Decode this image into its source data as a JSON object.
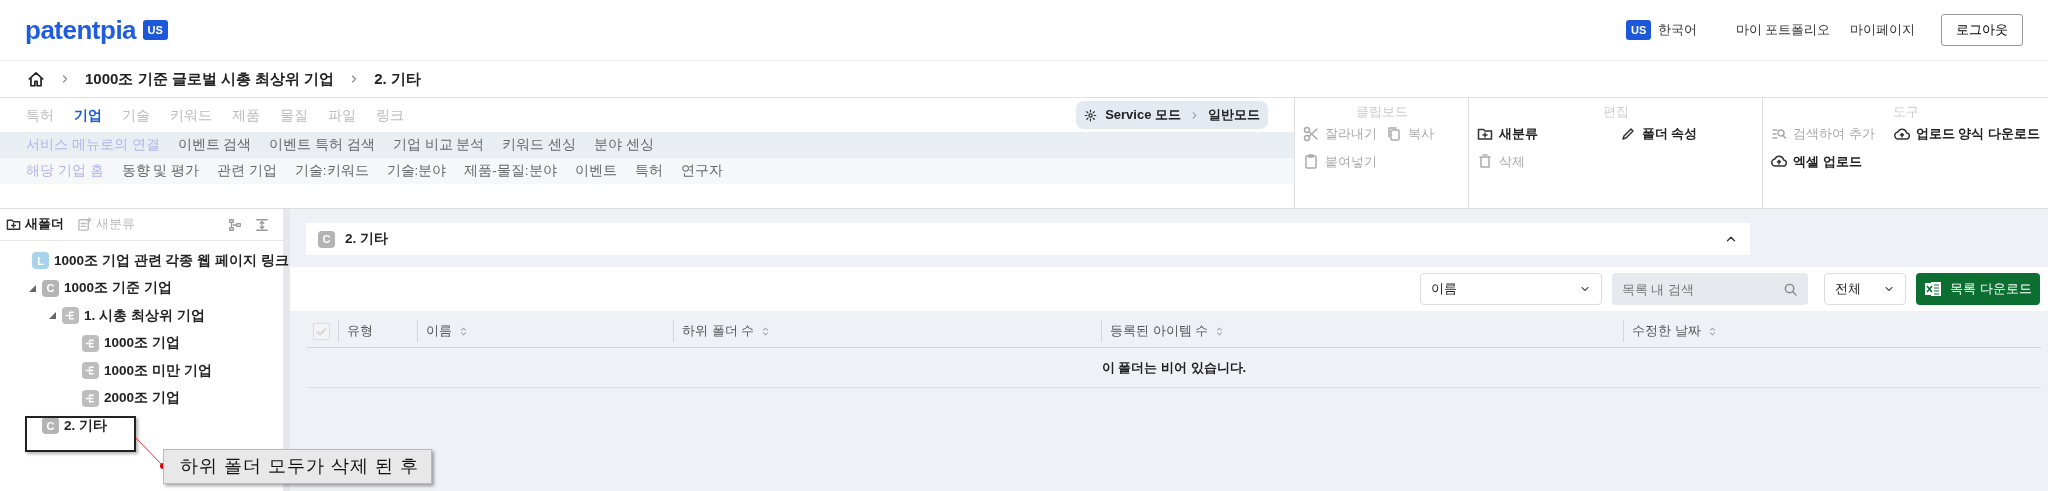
{
  "header": {
    "logo": "patentpia",
    "logo_badge": "US",
    "language_badge": "US",
    "language": "한국어",
    "links": [
      "마이 포트폴리오",
      "마이페이지"
    ],
    "logout": "로그아웃"
  },
  "breadcrumb": [
    "1000조 기준 글로벌 시총 최상위 기업",
    "2. 기타"
  ],
  "ribbon": {
    "tabs": [
      {
        "label": "특허",
        "selected": false
      },
      {
        "label": "기업",
        "selected": true
      },
      {
        "label": "기술",
        "selected": false
      },
      {
        "label": "키워드",
        "selected": false
      },
      {
        "label": "제품",
        "selected": false
      },
      {
        "label": "물질",
        "selected": false
      },
      {
        "label": "파일",
        "selected": false
      },
      {
        "label": "링크",
        "selected": false
      }
    ],
    "mode": {
      "from": "Service 모드",
      "to": "일반모드"
    },
    "menus": [
      {
        "title": "서비스 메뉴로의 연결",
        "items": [
          "이벤트 검색",
          "이벤트 특허 검색",
          "기업 비교 분석",
          "키워드 센싱",
          "분야 센싱"
        ]
      },
      {
        "title": "해당 기업 홈",
        "items": [
          "동향 및 평가",
          "관련 기업",
          "기술:키워드",
          "기술:분야",
          "제품-물질:분야",
          "이벤트",
          "특허",
          "연구자"
        ]
      }
    ],
    "groups": [
      {
        "title": "클립보드",
        "actions": [
          {
            "label": "잘라내기",
            "kind": "scissors",
            "disabled": true
          },
          {
            "label": "복사",
            "kind": "copy",
            "disabled": true
          },
          {
            "label": "붙여넣기",
            "kind": "clipboard",
            "disabled": true
          }
        ]
      },
      {
        "title": "편집",
        "actions": [
          {
            "label": "새분류",
            "kind": "folder-plus",
            "disabled": false
          },
          {
            "label": "폴더 속성",
            "kind": "pencil",
            "disabled": false
          },
          {
            "label": "삭제",
            "kind": "trash",
            "disabled": true
          }
        ]
      },
      {
        "title": "도구",
        "actions": [
          {
            "label": "검색하여 추가",
            "kind": "list-search",
            "disabled": true
          },
          {
            "label": "업로드 양식 다운로드",
            "kind": "cloud-upload",
            "disabled": false
          },
          {
            "label": "엑셀 업로드",
            "kind": "cloud-upload",
            "disabled": false
          }
        ]
      }
    ]
  },
  "sidebar": {
    "toolbar": [
      {
        "label": "새폴더",
        "kind": "folder-plus",
        "disabled": false
      },
      {
        "label": "새분류",
        "kind": "list-plus",
        "disabled": true
      }
    ],
    "tree": [
      {
        "label": "1000조 기업 관련 각종 웹 페이지 링크",
        "kind": "link",
        "badge": "L"
      },
      {
        "label": "1000조 기준 기업",
        "kind": "category",
        "badge": "C",
        "expanded": true,
        "children": [
          {
            "label": "1. 시총 최상위 기업",
            "kind": "entry",
            "expanded": true,
            "children": [
              {
                "label": "1000조 기업",
                "kind": "entry"
              },
              {
                "label": "1000조 미만 기업",
                "kind": "entry"
              },
              {
                "label": "2000조 기업",
                "kind": "entry"
              }
            ]
          }
        ]
      },
      {
        "label": "2. 기타",
        "kind": "category",
        "badge": "C"
      }
    ]
  },
  "annotation": {
    "text": "하위 폴더 모두가 삭제 된 후"
  },
  "main": {
    "folder": {
      "badge": "C",
      "title": "2. 기타"
    },
    "field_select": "이름",
    "search_placeholder": "목록 내 검색",
    "filter_select": "전체",
    "download": "목록 다운로드",
    "table": {
      "select_all": {
        "disabled": true
      },
      "columns": [
        {
          "label": "유형",
          "sortable": false
        },
        {
          "label": "이름",
          "sortable": true
        },
        {
          "label": "하위 폴더 수",
          "sortable": true
        },
        {
          "label": "등록된 아이템 수",
          "sortable": true
        },
        {
          "label": "수정한 날짜",
          "sortable": true
        }
      ],
      "empty_message": "이 폴더는 비어 있습니다."
    }
  }
}
